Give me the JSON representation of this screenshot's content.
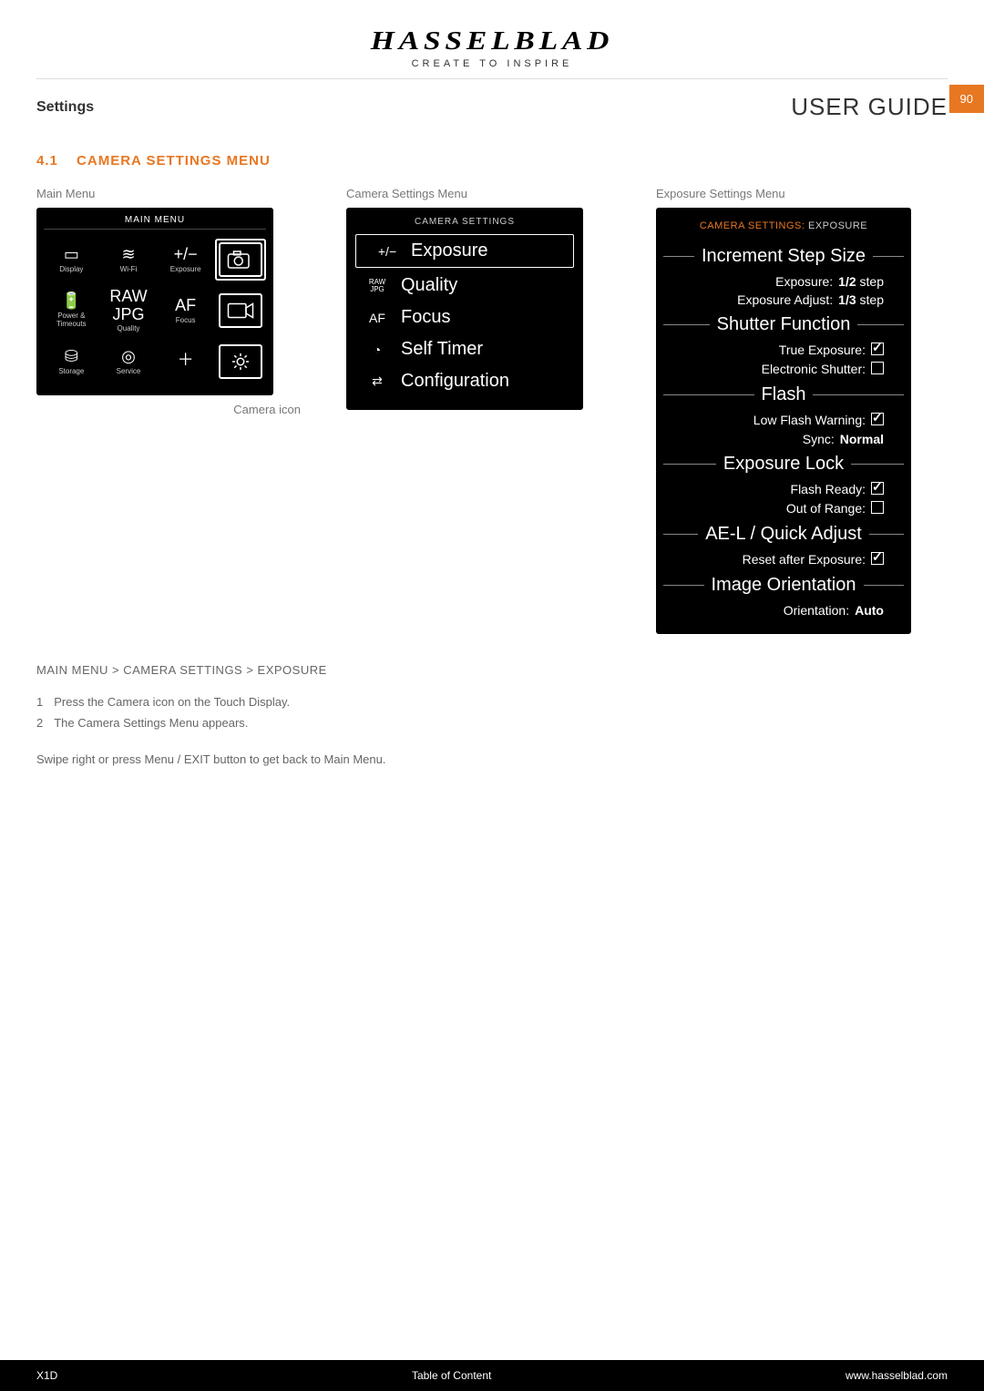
{
  "brand": "HASSELBLAD",
  "tagline": "CREATE TO INSPIRE",
  "subheader": {
    "left": "Settings",
    "right": "USER GUIDE",
    "page": "90"
  },
  "section": {
    "num": "4.1",
    "title": "CAMERA SETTINGS MENU"
  },
  "captions": {
    "main_menu": "Main Menu",
    "camera_icon": "Camera icon",
    "camera_settings_menu": "Camera Settings Menu",
    "exposure_settings_menu": "Exposure Settings Menu"
  },
  "main_menu_screen": {
    "title": "MAIN MENU",
    "items": [
      {
        "icon": "▭",
        "label": "Display"
      },
      {
        "icon": "≋",
        "label": "Wi-Fi"
      },
      {
        "icon": "+/−",
        "label": "Exposure"
      },
      {
        "icon": "🔋",
        "label": "Power & Timeouts"
      },
      {
        "icon": "RAW JPG",
        "label": "Quality"
      },
      {
        "icon": "AF",
        "label": "Focus"
      },
      {
        "icon": "⛁",
        "label": "Storage"
      },
      {
        "icon": "◎",
        "label": "Service"
      },
      {
        "icon": "＋",
        "label": ""
      }
    ],
    "side": [
      {
        "name": "camera-icon"
      },
      {
        "name": "video-icon"
      },
      {
        "name": "gear-icon"
      }
    ]
  },
  "settings_screen": {
    "title": "CAMERA SETTINGS",
    "rows": [
      {
        "icon": "+/−",
        "label": "Exposure",
        "name": "menu-exposure",
        "selected": true
      },
      {
        "icon": "RAW JPG",
        "label": "Quality",
        "name": "menu-quality"
      },
      {
        "icon": "AF",
        "label": "Focus",
        "name": "menu-focus"
      },
      {
        "icon": "◔",
        "label": "Self Timer",
        "name": "menu-selftimer"
      },
      {
        "icon": "⇄",
        "label": "Configuration",
        "name": "menu-configuration"
      }
    ]
  },
  "exposure_screen": {
    "crumb_orange": "CAMERA SETTINGS:",
    "crumb_white": "EXPOSURE",
    "groups": [
      {
        "title": "Increment Step Size",
        "rows": [
          {
            "k": "Exposure:",
            "v": "1/2",
            "unit": "step"
          },
          {
            "k": "Exposure Adjust:",
            "v": "1/3",
            "unit": "step"
          }
        ]
      },
      {
        "title": "Shutter Function",
        "rows": [
          {
            "k": "True Exposure:",
            "check": true
          },
          {
            "k": "Electronic Shutter:",
            "check": false
          }
        ]
      },
      {
        "title": "Flash",
        "rows": [
          {
            "k": "Low Flash Warning:",
            "check": true
          },
          {
            "k": "Sync:",
            "v": "Normal"
          }
        ]
      },
      {
        "title": "Exposure Lock",
        "rows": [
          {
            "k": "Flash Ready:",
            "check": true
          },
          {
            "k": "Out of Range:",
            "check": false
          }
        ]
      },
      {
        "title": "AE-L / Quick Adjust",
        "rows": [
          {
            "k": "Reset after Exposure:",
            "check": true
          }
        ]
      },
      {
        "title": "Image Orientation",
        "rows": [
          {
            "k": "Orientation:",
            "v": "Auto"
          }
        ]
      }
    ]
  },
  "body": {
    "crumb": "MAIN MENU > CAMERA SETTINGS > EXPOSURE",
    "steps": [
      "Press the Camera icon on the Touch Display.",
      "The Camera Settings Menu appears."
    ],
    "hint": "Swipe right or press Menu / EXIT button to get back to Main Menu."
  },
  "footer": {
    "left": "X1D",
    "center": "Table of Content",
    "right": "www.hasselblad.com"
  }
}
